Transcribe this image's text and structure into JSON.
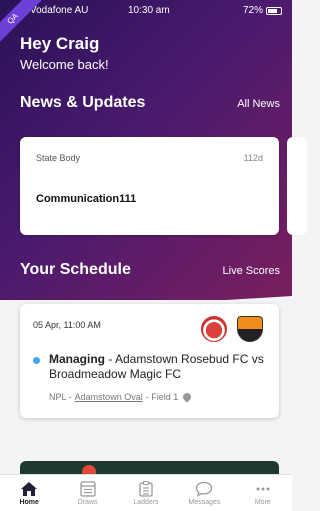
{
  "status_bar": {
    "carrier": "Vodafone AU",
    "time": "10:30 am",
    "battery": "72%"
  },
  "ribbon": "QA",
  "greeting": {
    "title": "Hey Craig",
    "subtitle": "Welcome back!"
  },
  "news": {
    "title": "News & Updates",
    "link": "All News",
    "card": {
      "source": "State Body",
      "age": "112d",
      "headline": "Communication111"
    }
  },
  "schedule": {
    "title": "Your Schedule",
    "link": "Live Scores",
    "game": {
      "datetime": "05 Apr, 11:00 AM",
      "status": "Managing",
      "matchup": " - Adamstown Rosebud FC vs Broadmeadow Magic FC",
      "competition": "NPL - ",
      "venue": "Adamstown Oval",
      "field": " - Field 1"
    }
  },
  "tabs": [
    {
      "label": "Home",
      "icon": "home-icon"
    },
    {
      "label": "Draws",
      "icon": "draws-icon"
    },
    {
      "label": "Ladders",
      "icon": "ladders-icon"
    },
    {
      "label": "Messages",
      "icon": "messages-icon"
    },
    {
      "label": "More",
      "icon": "more-icon"
    }
  ],
  "colors": {
    "hero_start": "#2a1258",
    "hero_end": "#7a1f5e",
    "status_dot": "#43a6f0"
  }
}
